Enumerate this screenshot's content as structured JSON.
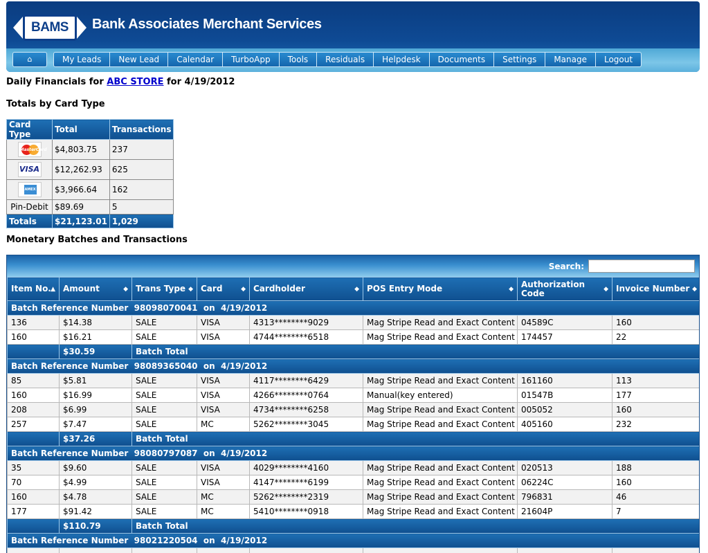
{
  "brand": {
    "logo_text": "BAMS",
    "title": "Bank Associates Merchant Services"
  },
  "nav": {
    "home_icon": "home-icon",
    "items": [
      "My Leads",
      "New Lead",
      "Calendar",
      "TurboApp",
      "Tools",
      "Residuals",
      "Helpdesk",
      "Documents",
      "Settings",
      "Manage",
      "Logout"
    ]
  },
  "heading": {
    "prefix": "Daily Financials for",
    "store": "ABC STORE",
    "suffix": "for 4/19/2012"
  },
  "totals_section": {
    "title": "Totals by Card Type",
    "columns": [
      "Card Type",
      "Total",
      "Transactions"
    ],
    "rows": [
      {
        "card_icon": "mastercard-logo",
        "logo_text": "MasterCard",
        "total": "$4,803.75",
        "transactions": "237"
      },
      {
        "card_icon": "visa-logo",
        "logo_text": "VISA",
        "total": "$12,262.93",
        "transactions": "625"
      },
      {
        "card_icon": "amex-logo",
        "logo_text": "AMEX",
        "total": "$3,966.64",
        "transactions": "162"
      },
      {
        "card_label": "Pin-Debit",
        "total": "$89.69",
        "transactions": "5"
      }
    ],
    "totals_row": {
      "label": "Totals",
      "total": "$21,123.01",
      "transactions": "1,029"
    }
  },
  "monetary_section": {
    "title": "Monetary Batches and Transactions",
    "search_label": "Search:",
    "search_value": "",
    "columns": [
      "Item No.",
      "Amount",
      "Trans Type",
      "Card",
      "Cardholder",
      "POS Entry Mode",
      "Authorization Code",
      "Invoice Number"
    ],
    "batch_total_label": "Batch Total",
    "batches": [
      {
        "header": "Batch Reference Number  98098070041  on  4/19/2012",
        "rows": [
          [
            "136",
            "$14.38",
            "SALE",
            "VISA",
            "4313********9029",
            "Mag Stripe Read and Exact Content",
            "04589C",
            "160"
          ],
          [
            "160",
            "$16.21",
            "SALE",
            "VISA",
            "4744********6518",
            "Mag Stripe Read and Exact Content",
            "174457",
            "22"
          ]
        ],
        "total": "$30.59"
      },
      {
        "header": "Batch Reference Number  98089365040  on  4/19/2012",
        "rows": [
          [
            "85",
            "$5.81",
            "SALE",
            "VISA",
            "4117********6429",
            "Mag Stripe Read and Exact Content",
            "161160",
            "113"
          ],
          [
            "160",
            "$16.99",
            "SALE",
            "VISA",
            "4266********0764",
            "Manual(key entered)",
            "01547B",
            "177"
          ],
          [
            "208",
            "$6.99",
            "SALE",
            "VISA",
            "4734********6258",
            "Mag Stripe Read and Exact Content",
            "005052",
            "160"
          ],
          [
            "257",
            "$7.47",
            "SALE",
            "MC",
            "5262********3045",
            "Mag Stripe Read and Exact Content",
            "405160",
            "232"
          ]
        ],
        "total": "$37.26"
      },
      {
        "header": "Batch Reference Number  98080797087  on  4/19/2012",
        "rows": [
          [
            "35",
            "$9.60",
            "SALE",
            "VISA",
            "4029********4160",
            "Mag Stripe Read and Exact Content",
            "020513",
            "188"
          ],
          [
            "70",
            "$4.99",
            "SALE",
            "VISA",
            "4147********6199",
            "Mag Stripe Read and Exact Content",
            "06224C",
            "160"
          ],
          [
            "160",
            "$4.78",
            "SALE",
            "MC",
            "5262********2319",
            "Mag Stripe Read and Exact Content",
            "796831",
            "46"
          ],
          [
            "177",
            "$91.42",
            "SALE",
            "MC",
            "5410********0918",
            "Mag Stripe Read and Exact Content",
            "21604P",
            "7"
          ]
        ],
        "total": "$110.79"
      },
      {
        "header": "Batch Reference Number  98021220504  on  4/19/2012",
        "rows": [
          [
            "",
            "",
            "",
            "",
            "",
            "",
            "",
            ""
          ]
        ],
        "total": null
      }
    ]
  },
  "colors": {
    "header_dark": "#0b3c80",
    "nav_light": "#7cc6e8",
    "table_header": "#1e6fb4",
    "row_alt": "#f2f2f2",
    "link": "#0000cc"
  }
}
